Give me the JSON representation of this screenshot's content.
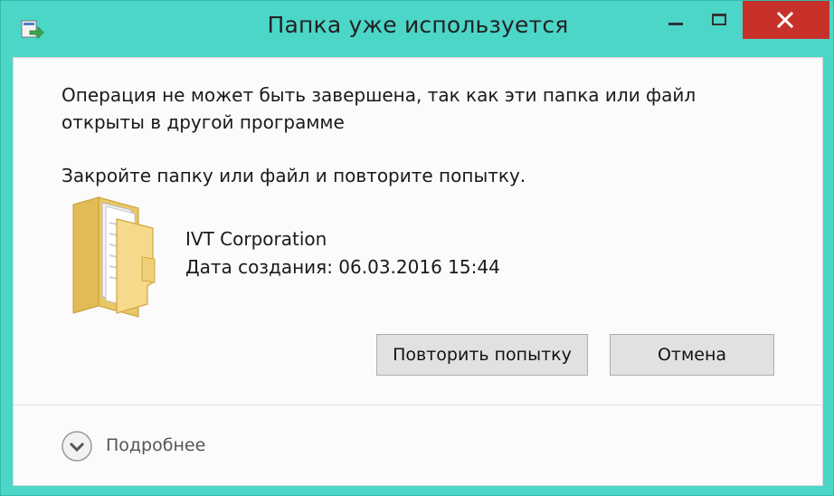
{
  "window": {
    "title": "Папка уже используется",
    "close_color": "#c7312a",
    "frame_color": "#4bd6c8"
  },
  "message": {
    "line1": "Операция не может быть завершена, так как эти папка или файл открыты в другой программе",
    "line2": "Закройте папку или файл и повторите попытку."
  },
  "file": {
    "icon": "folder-icon",
    "name": "IVT Corporation",
    "created": "Дата создания: 06.03.2016 15:44"
  },
  "buttons": {
    "retry": "Повторить попытку",
    "cancel": "Отмена"
  },
  "details": {
    "icon": "chevron-down-icon",
    "label": "Подробнее"
  }
}
